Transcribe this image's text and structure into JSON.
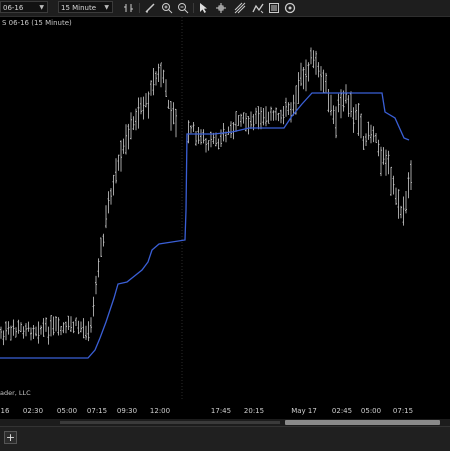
{
  "toolbar": {
    "instrument": "06-16",
    "interval": "15 Minute",
    "colors": {
      "accent": "#3a6cf0"
    },
    "icons": [
      "instrument-dropdown-icon",
      "interval-dropdown-icon",
      "bar-style-icon",
      "draw-pencil-icon",
      "zoom-in-icon",
      "zoom-out-icon",
      "pointer-icon",
      "crosshair-icon",
      "drawing-tools-icon",
      "strategy-icon",
      "data-box-icon",
      "properties-icon"
    ]
  },
  "chart": {
    "title": "S 06-16 (15 Minute)",
    "copyright": "ader, LLC"
  },
  "time_axis": {
    "labels": [
      "16",
      "02:30",
      "05:00",
      "07:15",
      "09:30",
      "12:00",
      "17:45",
      "20:15",
      "May 17",
      "02:45",
      "05:00",
      "07:15"
    ]
  },
  "tabs": {
    "add_label": "+"
  },
  "chart_data": {
    "type": "line",
    "series": [
      {
        "color": "#3a5fd6",
        "values": [
          [
            0,
            358
          ],
          [
            88,
            358
          ],
          [
            95,
            350
          ],
          [
            100,
            338
          ],
          [
            106,
            322
          ],
          [
            114,
            298
          ],
          [
            118,
            284
          ],
          [
            127,
            282
          ],
          [
            132,
            278
          ],
          [
            142,
            270
          ],
          [
            148,
            262
          ],
          [
            152,
            250
          ],
          [
            159,
            244
          ],
          [
            185,
            240
          ],
          [
            186,
            210
          ],
          [
            187,
            134
          ],
          [
            214,
            134
          ],
          [
            232,
            132
          ],
          [
            249,
            128
          ],
          [
            284,
            128
          ],
          [
            292,
            116
          ],
          [
            302,
            104
          ],
          [
            312,
            93
          ],
          [
            382,
            93
          ],
          [
            385,
            112
          ],
          [
            395,
            118
          ],
          [
            404,
            138
          ],
          [
            409,
            140
          ]
        ]
      },
      {
        "color": "#cccccc",
        "name": "price-bars"
      }
    ]
  }
}
